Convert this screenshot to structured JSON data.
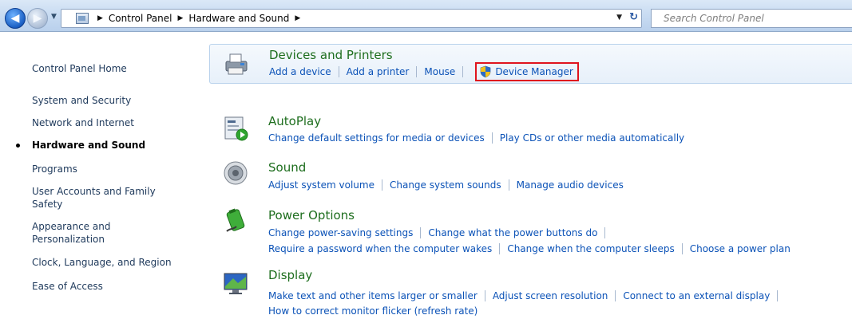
{
  "window": {
    "breadcrumbs": [
      "Control Panel",
      "Hardware and Sound"
    ],
    "search_placeholder": "Search Control Panel"
  },
  "left_nav": {
    "items": [
      {
        "label": "Control Panel Home"
      },
      {
        "label": "System and Security"
      },
      {
        "label": "Network and Internet"
      },
      {
        "label": "Hardware and Sound",
        "current": true
      },
      {
        "label": "Programs"
      },
      {
        "label": "User Accounts and Family Safety"
      },
      {
        "label": "Appearance and Personalization"
      },
      {
        "label": "Clock, Language, and Region"
      },
      {
        "label": "Ease of Access"
      }
    ]
  },
  "categories": [
    {
      "title": "Devices and Printers",
      "icon": "printer-icon",
      "links": [
        "Add a device",
        "Add a printer",
        "Mouse",
        "Device Manager"
      ],
      "highlighted_link": "Device Manager"
    },
    {
      "title": "AutoPlay",
      "icon": "autoplay-icon",
      "links": [
        "Change default settings for media or devices",
        "Play CDs or other media automatically"
      ]
    },
    {
      "title": "Sound",
      "icon": "speaker-icon",
      "links": [
        "Adjust system volume",
        "Change system sounds",
        "Manage audio devices"
      ]
    },
    {
      "title": "Power Options",
      "icon": "battery-icon",
      "links": [
        "Change power-saving settings",
        "Change what the power buttons do"
      ],
      "links_row2": [
        "Require a password when the computer wakes",
        "Change when the computer sleeps",
        "Choose a power plan"
      ]
    },
    {
      "title": "Display",
      "icon": "monitor-icon",
      "links": [
        "Make text and other items larger or smaller",
        "Adjust screen resolution",
        "Connect to an external display"
      ],
      "links_row2": [
        "How to correct monitor flicker (refresh rate)"
      ]
    }
  ],
  "colors": {
    "link": "#0b52b7",
    "category_title": "#1e6e1e",
    "highlight_border": "#e0141e"
  }
}
